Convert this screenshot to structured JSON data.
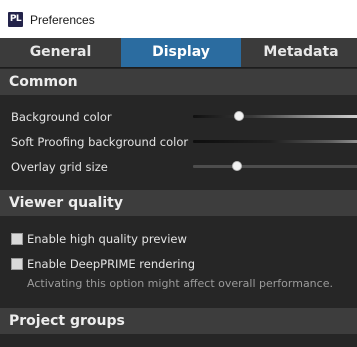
{
  "window": {
    "logo_text": "PL",
    "title": "Preferences"
  },
  "tabs": [
    {
      "label": "General",
      "active": false
    },
    {
      "label": "Display",
      "active": true
    },
    {
      "label": "Metadata",
      "active": false
    }
  ],
  "sections": {
    "common": {
      "title": "Common",
      "background_color": {
        "label": "Background color",
        "value_fraction": 0.27
      },
      "soft_proofing_color": {
        "label": "Soft Proofing background color",
        "value_fraction": 0.0
      },
      "overlay_grid_size": {
        "label": "Overlay grid size",
        "value_fraction": 0.25
      }
    },
    "viewer_quality": {
      "title": "Viewer quality",
      "high_quality_preview": {
        "label": "Enable high quality preview",
        "checked": false
      },
      "deepprime_rendering": {
        "label": "Enable DeepPRIME rendering",
        "checked": false
      },
      "deepprime_hint": "Activating this option might affect overall performance."
    },
    "project_groups": {
      "title": "Project groups"
    }
  },
  "colors": {
    "accent": "#2b6ca0",
    "background": "#262626",
    "section_header": "#3d3d3d"
  }
}
